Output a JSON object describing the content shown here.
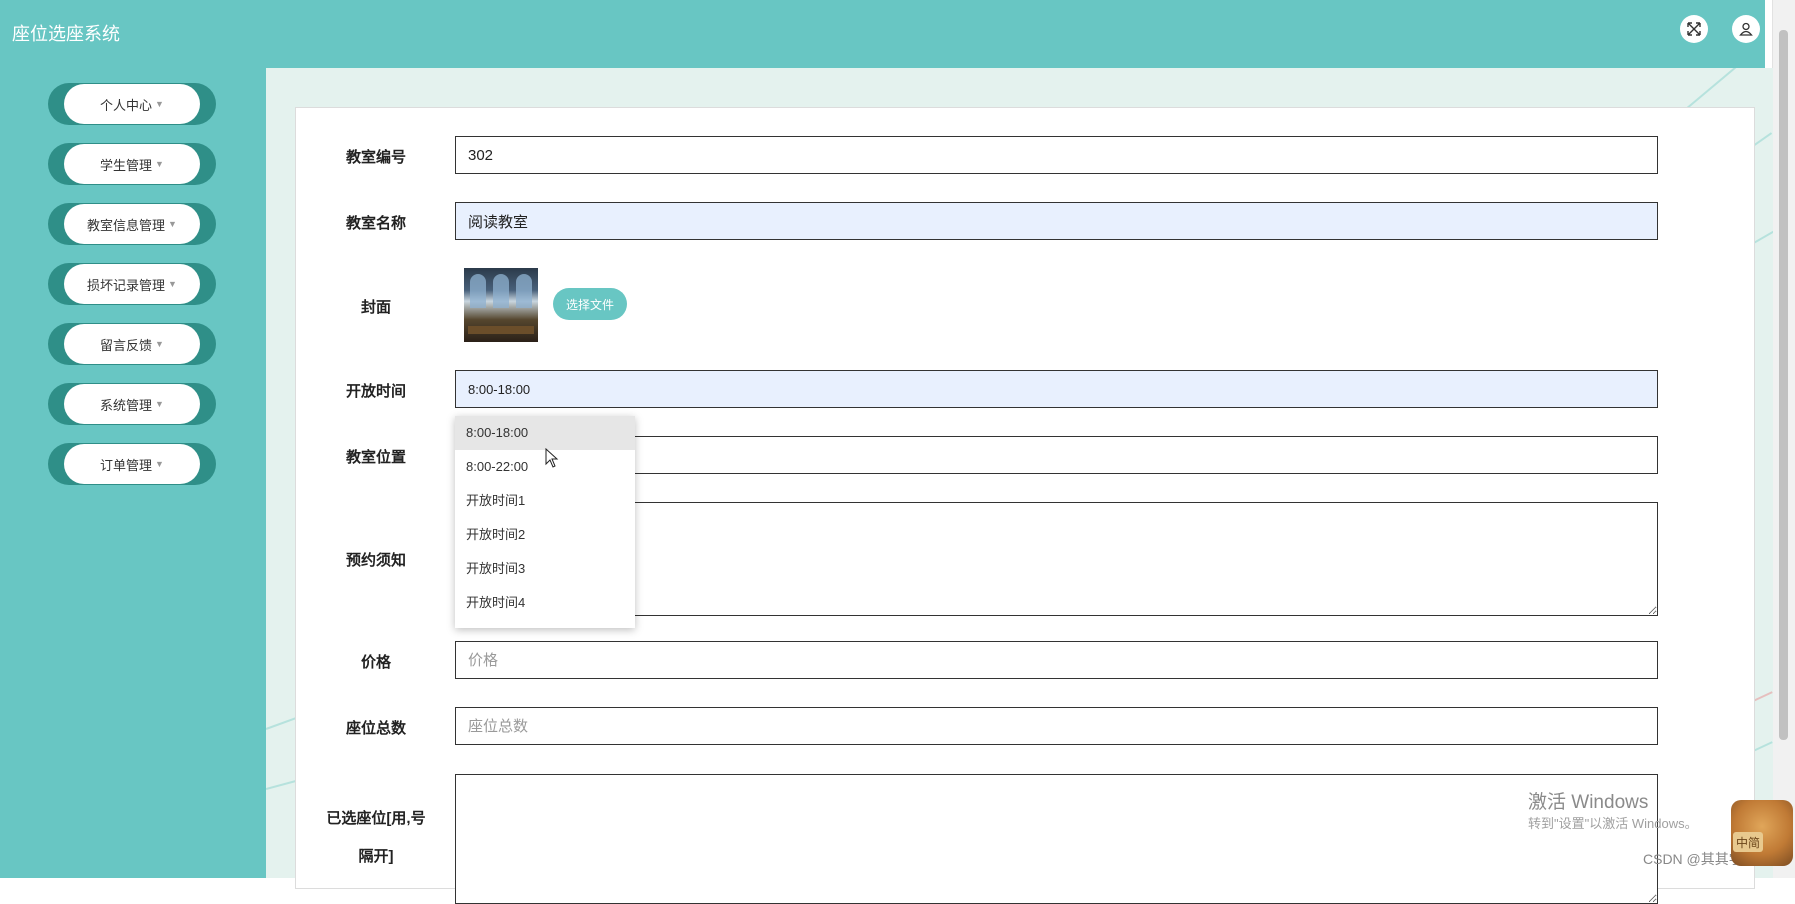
{
  "app": {
    "title": "座位选座系统"
  },
  "topbar": {
    "fullscreen_icon": "expand-icon",
    "user_icon": "user-icon"
  },
  "sidebar": {
    "items": [
      {
        "label": "个人中心"
      },
      {
        "label": "学生管理"
      },
      {
        "label": "教室信息管理"
      },
      {
        "label": "损坏记录管理"
      },
      {
        "label": "留言反馈"
      },
      {
        "label": "系统管理"
      },
      {
        "label": "订单管理"
      }
    ]
  },
  "form": {
    "classroom_no": {
      "label": "教室编号",
      "value": "302"
    },
    "classroom_name": {
      "label": "教室名称",
      "value": "阅读教室"
    },
    "cover": {
      "label": "封面",
      "button": "选择文件"
    },
    "open_time": {
      "label": "开放时间",
      "value": "8:00-18:00",
      "options": [
        "8:00-18:00",
        "8:00-22:00",
        "开放时间1",
        "开放时间2",
        "开放时间3",
        "开放时间4"
      ]
    },
    "location": {
      "label": "教室位置",
      "value": ""
    },
    "notice": {
      "label": "预约须知",
      "value": ""
    },
    "price": {
      "label": "价格",
      "placeholder": "价格"
    },
    "seat_total": {
      "label": "座位总数",
      "placeholder": "座位总数"
    },
    "selected_seats": {
      "label": "已选座位[用,号隔开]",
      "value": ""
    }
  },
  "overlay": {
    "activate_title": "激活 Windows",
    "activate_sub": "转到\"设置\"以激活 Windows。",
    "csdn": "CSDN @其其学姐",
    "dog_tag": "中简"
  }
}
